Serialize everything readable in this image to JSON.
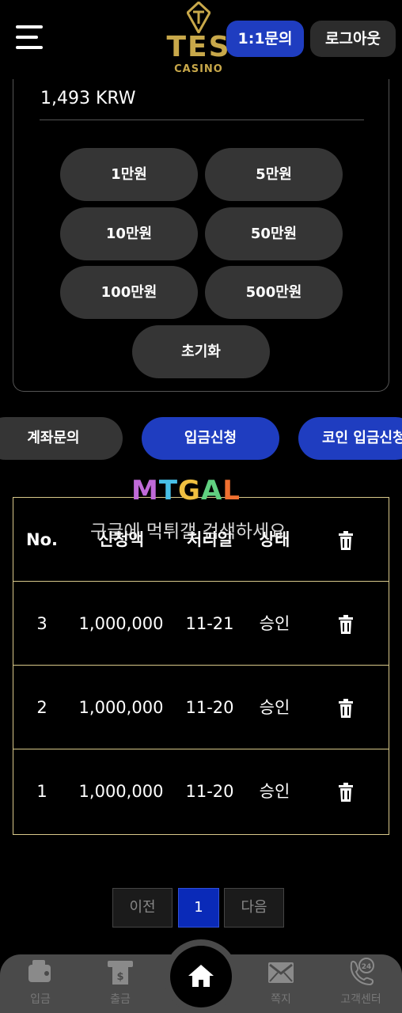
{
  "header": {
    "logo_text": "TES",
    "logo_sub": "CASINO",
    "inquiry_label": "1:1문의",
    "logout_label": "로그아웃"
  },
  "deposit": {
    "amount": "1,493 KRW",
    "quick_amounts": [
      "1만원",
      "5만원",
      "10만원",
      "50만원",
      "100만원",
      "500만원"
    ],
    "reset_label": "초기화"
  },
  "tabs": [
    {
      "label": "계좌문의",
      "active": false
    },
    {
      "label": "입금신청",
      "active": true
    },
    {
      "label": "코인 입금신청",
      "active": false
    }
  ],
  "watermark": {
    "logo": [
      "M",
      "T",
      "G",
      "A",
      "L"
    ],
    "text": "구글에 먹튀갤 검색하세요"
  },
  "history_table": {
    "columns": [
      "No.",
      "신청액",
      "처리일",
      "상태",
      ""
    ],
    "rows": [
      {
        "no": "3",
        "amount": "1,000,000",
        "date": "11-21",
        "status": "승인"
      },
      {
        "no": "2",
        "amount": "1,000,000",
        "date": "11-20",
        "status": "승인"
      },
      {
        "no": "1",
        "amount": "1,000,000",
        "date": "11-20",
        "status": "승인"
      }
    ]
  },
  "pagination": {
    "prev_label": "이전",
    "current_page": "1",
    "next_label": "다음"
  },
  "bottom_nav": {
    "items": [
      {
        "label": "입금",
        "icon": "wallet-icon"
      },
      {
        "label": "출금",
        "icon": "atm-icon"
      },
      {
        "label": "",
        "icon": "home-icon"
      },
      {
        "label": "쪽지",
        "icon": "mail-icon"
      },
      {
        "label": "고객센터",
        "icon": "support-24-icon"
      }
    ]
  },
  "colors": {
    "accent_blue": "#1f3dc0",
    "gold": "#c8a84a",
    "table_border": "#d8c88a",
    "button_gray": "#353535"
  }
}
